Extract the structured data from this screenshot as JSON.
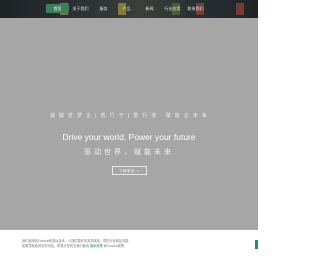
{
  "nav": {
    "items": [
      "首页",
      "关于我们",
      "服务",
      "产品",
      "新闻",
      "行业应用",
      "联系我们"
    ],
    "active_index": 0,
    "accent_color": "#3d7f5a"
  },
  "hero": {
    "tagline": "诚  赋  莅  梦  企 | 携 行 于 | 携 行 途 · 赋 能 企 未 来",
    "headline_en": "Drive your world, Power your future",
    "headline_cn": "驱动世界，赋能未来",
    "button_label": "了解更多 →"
  },
  "cookie": {
    "text_line1": "我们使用的Cookie和类似技术，以提供更好的浏览体验，同时分析网站流量，",
    "text_line2_prefix": "如果您继续浏览本网站，即表示您同意我们使用",
    "link_text": "隐私政策",
    "text_line2_suffix": "和Cookie政策"
  }
}
